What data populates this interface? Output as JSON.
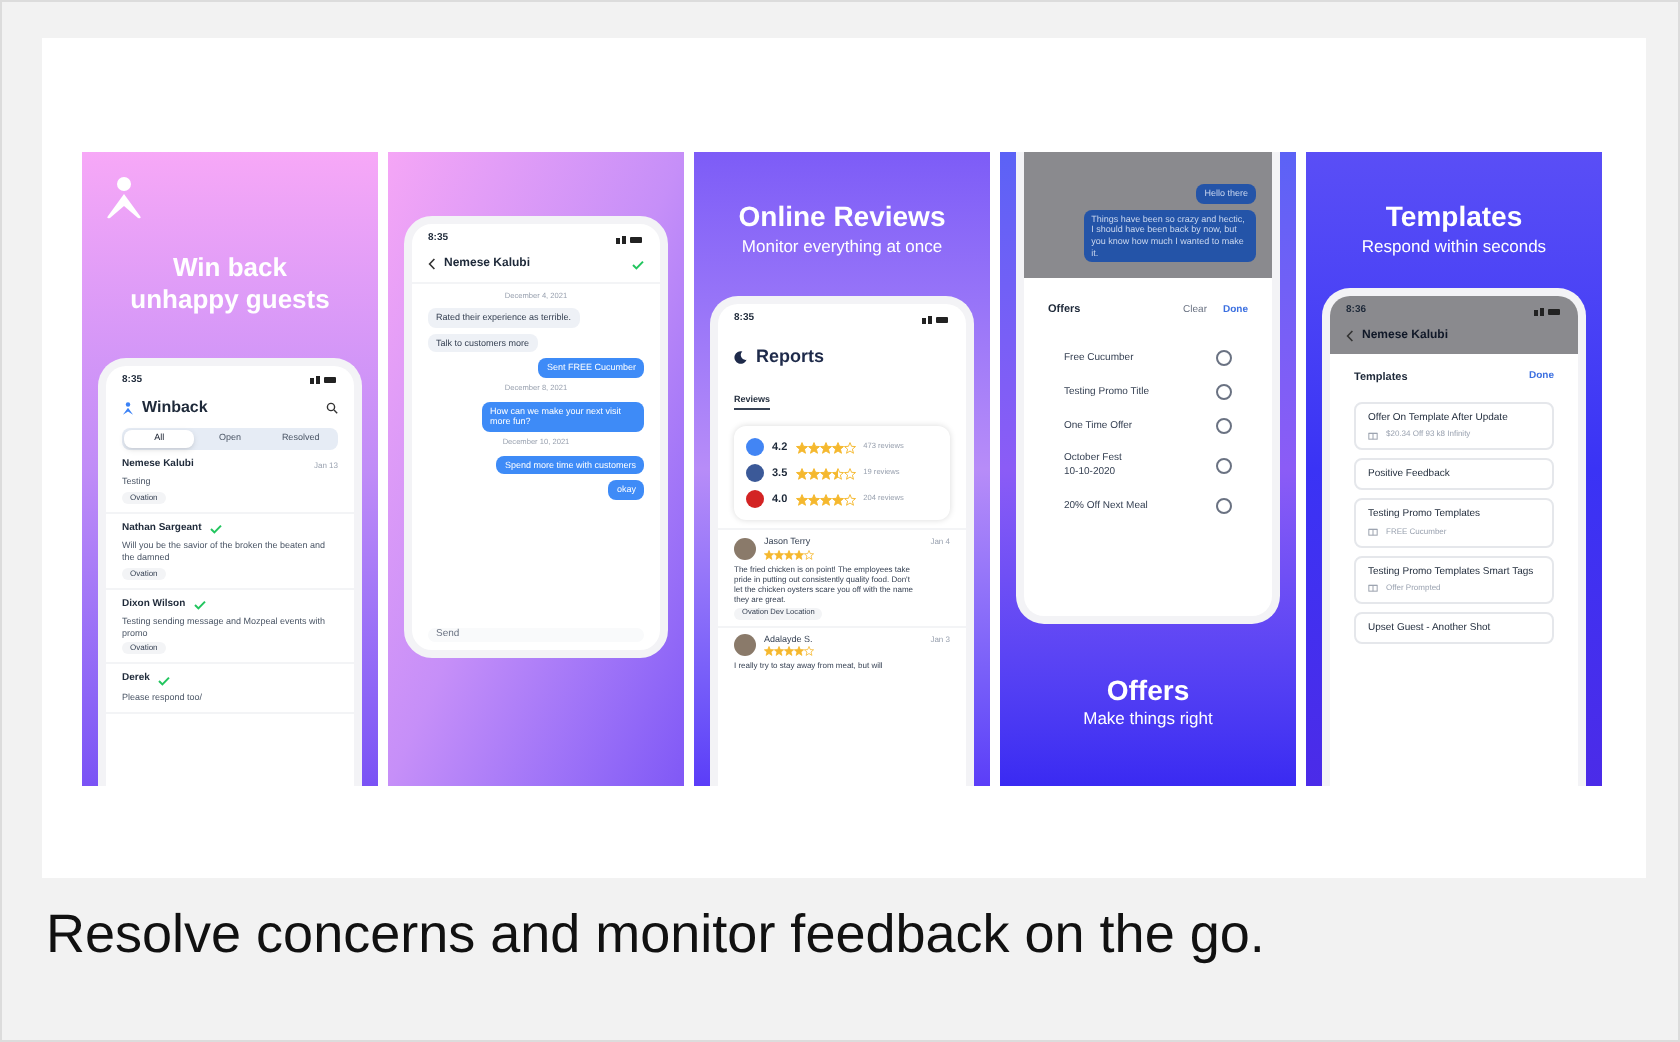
{
  "panels": [
    {
      "kind": "winback",
      "headline": "Win back unhappy guests",
      "phone": {
        "time": "8:35",
        "title": "Winback",
        "tabs": [
          {
            "label": "All",
            "selected": true
          },
          {
            "label": "Open",
            "selected": false
          },
          {
            "label": "Resolved",
            "selected": false
          }
        ],
        "conversations": [
          {
            "name": "Nemese Kalubi",
            "resolved": false,
            "preview": "Testing",
            "tag": "Ovation",
            "date": "Jan 13"
          },
          {
            "name": "Nathan Sargeant",
            "resolved": true,
            "preview": "Will you be the savior of the broken the beaten and the damned",
            "tag": "Ovation"
          },
          {
            "name": "Dixon Wilson",
            "resolved": true,
            "preview": "Testing sending message and Mozpeal events with promo",
            "tag": "Ovation"
          },
          {
            "name": "Derek",
            "resolved": true,
            "preview": "Please respond too/"
          }
        ]
      }
    },
    {
      "kind": "chat",
      "phone": {
        "time": "8:35",
        "contact": "Nemese Kalubi",
        "messages": [
          {
            "kind": "date",
            "text": "December 4, 2021"
          },
          {
            "kind": "note",
            "text": "Rated their experience as terrible."
          },
          {
            "kind": "note",
            "text": "Talk to customers more"
          },
          {
            "kind": "outgoing",
            "text": "Sent FREE Cucumber"
          },
          {
            "kind": "date",
            "text": "December 8, 2021"
          },
          {
            "kind": "outgoing",
            "text": "How can we make your next visit more fun?"
          },
          {
            "kind": "date",
            "text": "December 10, 2021"
          },
          {
            "kind": "outgoing",
            "text": "Spend more time with customers"
          },
          {
            "kind": "outgoing",
            "text": "okay"
          }
        ],
        "placeholder": "Send"
      }
    },
    {
      "kind": "reviews",
      "headline": "Online Reviews",
      "subhead": "Monitor everything at once",
      "phone": {
        "time": "8:35",
        "title": "Reports",
        "tab": "Reviews",
        "ratings": [
          {
            "score": "4.2",
            "stars": 4,
            "count": "473 reviews",
            "color": "#4285f4"
          },
          {
            "score": "3.5",
            "stars": 3.5,
            "count": "19 reviews",
            "color": "#3b5998"
          },
          {
            "score": "4.0",
            "stars": 4,
            "count": "204 reviews",
            "color": "#d32323"
          }
        ],
        "reviews": [
          {
            "name": "Jason Terry",
            "stars": 4,
            "date": "Jan 4",
            "text": "The fried chicken is on point! The employees take pride in putting out consistently quality food. Don't let the chicken oysters scare you off with the name they are great.",
            "tag": "Ovation Dev Location"
          },
          {
            "name": "Adalayde S.",
            "stars": 4,
            "date": "Jan 3",
            "text": "I really try to stay away from meat, but will"
          }
        ]
      }
    },
    {
      "kind": "offers",
      "headline": "Offers",
      "subhead": "Make things right",
      "phone": {
        "messages": [
          "Hello there",
          "Things have been so crazy and hectic, I should have been back by now, but you know how much I wanted to make it."
        ],
        "sheet_title": "Offers",
        "clear": "Clear",
        "done": "Done",
        "options": [
          {
            "label": "Free Cucumber",
            "selected": false
          },
          {
            "label": "Testing Promo Title",
            "selected": false
          },
          {
            "label": "One Time Offer",
            "selected": false
          },
          {
            "label": "October Fest\n10-10-2020",
            "selected": false
          },
          {
            "label": "20% Off Next Meal",
            "selected": false
          }
        ]
      }
    },
    {
      "kind": "templates",
      "headline": "Templates",
      "subhead": "Respond within seconds",
      "phone": {
        "time": "8:36",
        "contact": "Nemese Kalubi",
        "sheet_title": "Templates",
        "done": "Done",
        "templates": [
          {
            "title": "Offer On Template After Update",
            "offer": "$20.34 Off 93 k8 Infinity"
          },
          {
            "title": "Positive Feedback"
          },
          {
            "title": "Testing Promo Templates",
            "offer": "FREE Cucumber"
          },
          {
            "title": "Testing Promo Templates Smart Tags",
            "offer": "Offer Prompted"
          },
          {
            "title": "Upset Guest - Another Shot"
          }
        ]
      }
    }
  ],
  "caption": "Resolve concerns and monitor feedback on the go."
}
